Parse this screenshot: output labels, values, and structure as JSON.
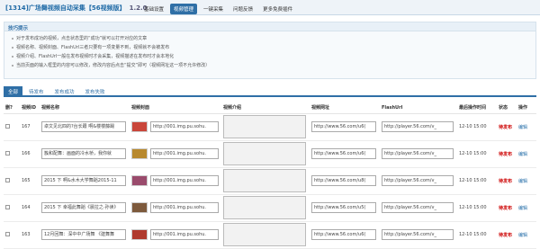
{
  "header": {
    "title": "[1314]广场舞视频自动采集【56视频版】",
    "version": "1.2.0",
    "nav": [
      {
        "label": "基础设置",
        "active": false
      },
      {
        "label": "视频管理",
        "active": true
      },
      {
        "label": "一键采集",
        "active": false
      },
      {
        "label": "问题反馈",
        "active": false
      },
      {
        "label": "更多免费插件",
        "active": false
      }
    ]
  },
  "tips": {
    "title": "技巧提示",
    "items": [
      "对于发布成功的视频，点击状态里的“成功”就可以打开对应的文章",
      "视频名称、视频封面、FlashUrl三者只要有一项变量不到，视频就不会被发布",
      "视频介绍、FlashUrl一般在发布视频时才会采集，视频描述在发布时才会本地化",
      "当前页面的输入框里的内容可以修改，修改内容后点击“提交”即可（视频网址这一项不允许修改）"
    ]
  },
  "tabs": [
    {
      "label": "全部",
      "active": true
    },
    {
      "label": "待发布",
      "active": false
    },
    {
      "label": "发布成功",
      "active": false
    },
    {
      "label": "发布失败",
      "active": false
    }
  ],
  "table": {
    "headers": [
      "删?",
      "视频ID",
      "视频名称",
      "视频封面",
      "视频介绍",
      "视频网址",
      "FlashUrl",
      "最后操作时间",
      "状态",
      "操作"
    ],
    "rows": [
      {
        "id": "167",
        "name": "卓文见北四的?台长跟 啊&楼楼藤踢",
        "cover": "http://001.img.pu.sohu.",
        "url": "http://www.56.com/u6(",
        "flash": "http://player.56.com/v_",
        "time": "12-10 15:00",
        "status": "待发布",
        "op": "编辑",
        "thumb": "#c9463a"
      },
      {
        "id": "166",
        "name": "簇和配舞：画面的冷水桥，我你就",
        "cover": "http://001.img.pu.sohu.",
        "url": "http://www.56.com/u6(",
        "flash": "http://player.56.com/v_",
        "time": "12-10 15:00",
        "status": "待发布",
        "op": "编辑",
        "thumb": "#b8892e"
      },
      {
        "id": "165",
        "name": "2015 下 啊&水木大学舞蹈2015-11",
        "cover": "http://001.img.pu.sohu.",
        "url": "http://www.56.com/u8(",
        "flash": "http://player.56.com/v_",
        "time": "12-10 15:00",
        "status": "待发布",
        "op": "编辑",
        "thumb": "#9a4b6c"
      },
      {
        "id": "164",
        "name": "2015 下 幸福此舞蹈《晨拉之·孙读》",
        "cover": "http://001.img.pu.sohu.",
        "url": "http://www.56.com/u5(",
        "flash": "http://player.56.com/v_",
        "time": "12-10 15:00",
        "status": "待发布",
        "op": "编辑",
        "thumb": "#7d5a3c"
      },
      {
        "id": "163",
        "name": "12月回舞：深中中广场舞 《建舞舞",
        "cover": "http://001.img.pu.sohu.",
        "url": "http://www.56.com/u6(",
        "flash": "http://player.56.com/v_",
        "time": "12-10 15:00",
        "status": "待发布",
        "op": "编辑",
        "thumb": "#b03a2e"
      }
    ]
  }
}
